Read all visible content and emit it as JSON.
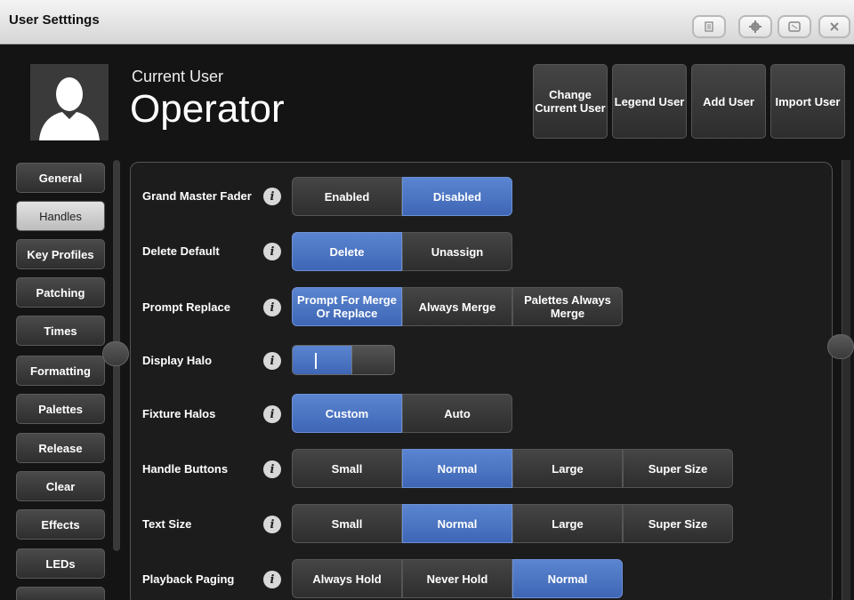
{
  "window": {
    "title": "User Setttings",
    "controls": [
      {
        "name": "menu-icon"
      },
      {
        "name": "gear-icon"
      },
      {
        "name": "screen-icon"
      },
      {
        "name": "close-icon"
      }
    ]
  },
  "header": {
    "current_user_label": "Current User",
    "user_name": "Operator",
    "buttons": [
      {
        "label": "Change Current User"
      },
      {
        "label": "Legend User"
      },
      {
        "label": "Add User"
      },
      {
        "label": "Import User"
      }
    ]
  },
  "sidebar": {
    "items": [
      {
        "label": "General",
        "active": false
      },
      {
        "label": "Handles",
        "active": true
      },
      {
        "label": "Key Profiles",
        "active": false
      },
      {
        "label": "Patching",
        "active": false
      },
      {
        "label": "Times",
        "active": false
      },
      {
        "label": "Formatting",
        "active": false
      },
      {
        "label": "Palettes",
        "active": false
      },
      {
        "label": "Release",
        "active": false
      },
      {
        "label": "Clear",
        "active": false
      },
      {
        "label": "Effects",
        "active": false
      },
      {
        "label": "LEDs",
        "active": false
      }
    ]
  },
  "settings": {
    "grand_master_fader": {
      "label": "Grand Master Fader",
      "options": [
        "Enabled",
        "Disabled"
      ],
      "selected": "Disabled"
    },
    "delete_default": {
      "label": "Delete Default",
      "options": [
        "Delete",
        "Unassign"
      ],
      "selected": "Delete"
    },
    "prompt_replace": {
      "label": "Prompt Replace",
      "options": [
        "Prompt For Merge Or Replace",
        "Always Merge",
        "Palettes Always Merge"
      ],
      "selected": "Prompt For Merge Or Replace"
    },
    "display_halo": {
      "label": "Display Halo",
      "level": 0.57
    },
    "fixture_halos": {
      "label": "Fixture Halos",
      "options": [
        "Custom",
        "Auto"
      ],
      "selected": "Custom"
    },
    "handle_buttons": {
      "label": "Handle Buttons",
      "options": [
        "Small",
        "Normal",
        "Large",
        "Super Size"
      ],
      "selected": "Normal"
    },
    "text_size": {
      "label": "Text Size",
      "options": [
        "Small",
        "Normal",
        "Large",
        "Super Size"
      ],
      "selected": "Normal"
    },
    "playback_paging": {
      "label": "Playback Paging",
      "options": [
        "Always Hold",
        "Never Hold",
        "Normal"
      ],
      "selected": "Normal"
    }
  },
  "info_glyph": "i",
  "colors": {
    "accent": "#4a74c4",
    "panel": "#1c1c1c",
    "titlebar": "#e6e6e6"
  }
}
